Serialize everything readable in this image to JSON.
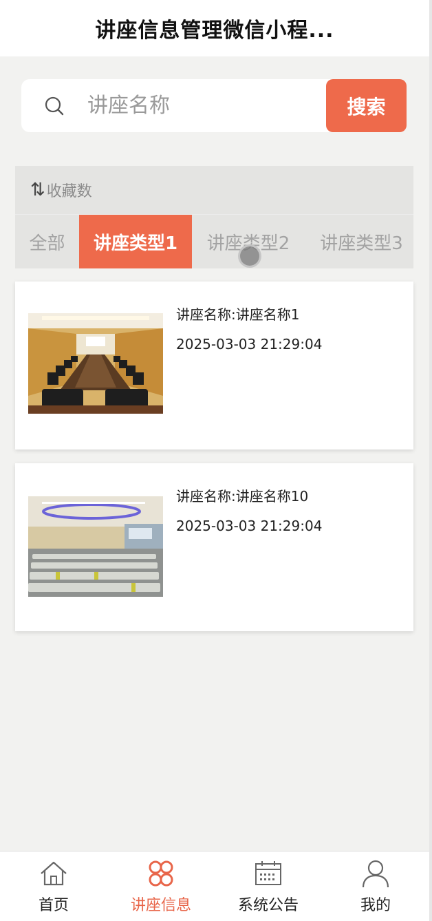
{
  "header": {
    "title": "讲座信息管理微信小程..."
  },
  "search": {
    "placeholder": "讲座名称",
    "value": "",
    "button_label": "搜索"
  },
  "sort": {
    "label": "收藏数",
    "icon": "sort-icon"
  },
  "tabs": [
    {
      "label": "全部",
      "active": false
    },
    {
      "label": "讲座类型1",
      "active": true
    },
    {
      "label": "讲座类型2",
      "active": false
    },
    {
      "label": "讲座类型3",
      "active": false
    }
  ],
  "cards": [
    {
      "name": "讲座名称:讲座名称1",
      "time": "2025-03-03 21:29:04",
      "image": "conference-room-photo"
    },
    {
      "name": "讲座名称:讲座名称10",
      "time": "2025-03-03 21:29:04",
      "image": "lecture-hall-photo"
    }
  ],
  "nav": [
    {
      "label": "首页",
      "icon": "home-icon",
      "active": false
    },
    {
      "label": "讲座信息",
      "icon": "lecture-icon",
      "active": true
    },
    {
      "label": "系统公告",
      "icon": "calendar-icon",
      "active": false
    },
    {
      "label": "我的",
      "icon": "user-icon",
      "active": false
    }
  ],
  "colors": {
    "accent": "#ee6a4b",
    "background": "#f2f2f0",
    "panel": "#e4e4e2"
  }
}
